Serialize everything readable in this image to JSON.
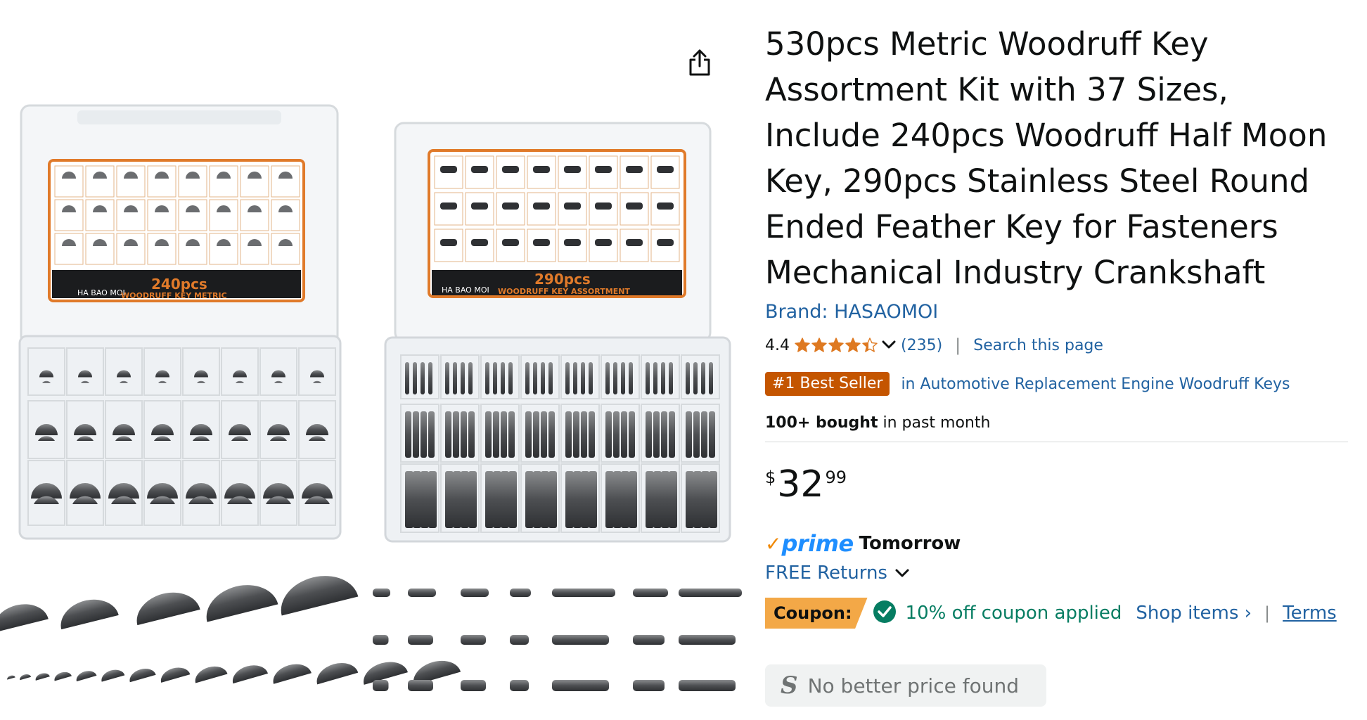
{
  "product": {
    "title": "530pcs Metric Woodruff Key Assortment Kit with 37 Sizes, Include 240pcs Woodruff Half Moon Key, 290pcs Stainless Steel Round Ended Feather Key for Fasteners Mechanical Industry Crankshaft",
    "brand": "Brand: HASAOMOI",
    "rating": "4.4",
    "stars_value": 4.4,
    "rating_count": "(235)",
    "search_link": "Search this page",
    "best_seller_badge": "#1 Best Seller",
    "best_seller_category": "in Automotive Replacement Engine Woodruff Keys",
    "bought_bold": "100+ bought",
    "bought_rest": " in past month",
    "price": {
      "symbol": "$",
      "whole": "32",
      "fraction": "99"
    },
    "prime": {
      "check": "✓",
      "word": "prime",
      "delivery": "Tomorrow"
    },
    "returns": "FREE Returns",
    "coupon": {
      "label": "Coupon:",
      "applied_text": "10% off coupon applied",
      "shop_items": "Shop items ›",
      "terms": "Terms"
    },
    "no_better_price": {
      "icon": "S",
      "text": "No better price found"
    }
  },
  "image_box": {
    "left_brand": "HA BAO MOI",
    "left_count": "240pcs",
    "left_name": "WOODRUFF KEY METRIC",
    "right_brand": "HA BAO MOI",
    "right_count": "290pcs",
    "right_name": "WOODRUFF KEY ASSORTMENT"
  },
  "colors": {
    "link": "#2162a1",
    "bestseller": "#c45500",
    "coupon": "#f3a847",
    "coupon_text": "#067d62",
    "prime_blue": "#1e8eff",
    "star": "#de7921"
  },
  "icons": {
    "share": "share-icon",
    "star": "star-icon",
    "chevron": "chevron-down-icon",
    "check": "check-circle-icon"
  }
}
